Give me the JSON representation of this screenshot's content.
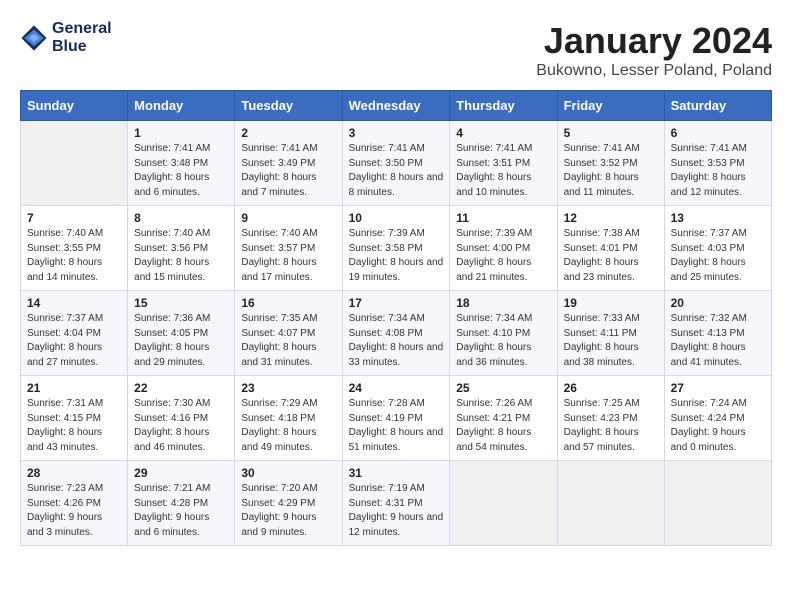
{
  "header": {
    "logo_line1": "General",
    "logo_line2": "Blue",
    "month": "January 2024",
    "location": "Bukowno, Lesser Poland, Poland"
  },
  "weekdays": [
    "Sunday",
    "Monday",
    "Tuesday",
    "Wednesday",
    "Thursday",
    "Friday",
    "Saturday"
  ],
  "weeks": [
    [
      {
        "day": "",
        "sunrise": "",
        "sunset": "",
        "daylight": ""
      },
      {
        "day": "1",
        "sunrise": "Sunrise: 7:41 AM",
        "sunset": "Sunset: 3:48 PM",
        "daylight": "Daylight: 8 hours and 6 minutes."
      },
      {
        "day": "2",
        "sunrise": "Sunrise: 7:41 AM",
        "sunset": "Sunset: 3:49 PM",
        "daylight": "Daylight: 8 hours and 7 minutes."
      },
      {
        "day": "3",
        "sunrise": "Sunrise: 7:41 AM",
        "sunset": "Sunset: 3:50 PM",
        "daylight": "Daylight: 8 hours and 8 minutes."
      },
      {
        "day": "4",
        "sunrise": "Sunrise: 7:41 AM",
        "sunset": "Sunset: 3:51 PM",
        "daylight": "Daylight: 8 hours and 10 minutes."
      },
      {
        "day": "5",
        "sunrise": "Sunrise: 7:41 AM",
        "sunset": "Sunset: 3:52 PM",
        "daylight": "Daylight: 8 hours and 11 minutes."
      },
      {
        "day": "6",
        "sunrise": "Sunrise: 7:41 AM",
        "sunset": "Sunset: 3:53 PM",
        "daylight": "Daylight: 8 hours and 12 minutes."
      }
    ],
    [
      {
        "day": "7",
        "sunrise": "Sunrise: 7:40 AM",
        "sunset": "Sunset: 3:55 PM",
        "daylight": "Daylight: 8 hours and 14 minutes."
      },
      {
        "day": "8",
        "sunrise": "Sunrise: 7:40 AM",
        "sunset": "Sunset: 3:56 PM",
        "daylight": "Daylight: 8 hours and 15 minutes."
      },
      {
        "day": "9",
        "sunrise": "Sunrise: 7:40 AM",
        "sunset": "Sunset: 3:57 PM",
        "daylight": "Daylight: 8 hours and 17 minutes."
      },
      {
        "day": "10",
        "sunrise": "Sunrise: 7:39 AM",
        "sunset": "Sunset: 3:58 PM",
        "daylight": "Daylight: 8 hours and 19 minutes."
      },
      {
        "day": "11",
        "sunrise": "Sunrise: 7:39 AM",
        "sunset": "Sunset: 4:00 PM",
        "daylight": "Daylight: 8 hours and 21 minutes."
      },
      {
        "day": "12",
        "sunrise": "Sunrise: 7:38 AM",
        "sunset": "Sunset: 4:01 PM",
        "daylight": "Daylight: 8 hours and 23 minutes."
      },
      {
        "day": "13",
        "sunrise": "Sunrise: 7:37 AM",
        "sunset": "Sunset: 4:03 PM",
        "daylight": "Daylight: 8 hours and 25 minutes."
      }
    ],
    [
      {
        "day": "14",
        "sunrise": "Sunrise: 7:37 AM",
        "sunset": "Sunset: 4:04 PM",
        "daylight": "Daylight: 8 hours and 27 minutes."
      },
      {
        "day": "15",
        "sunrise": "Sunrise: 7:36 AM",
        "sunset": "Sunset: 4:05 PM",
        "daylight": "Daylight: 8 hours and 29 minutes."
      },
      {
        "day": "16",
        "sunrise": "Sunrise: 7:35 AM",
        "sunset": "Sunset: 4:07 PM",
        "daylight": "Daylight: 8 hours and 31 minutes."
      },
      {
        "day": "17",
        "sunrise": "Sunrise: 7:34 AM",
        "sunset": "Sunset: 4:08 PM",
        "daylight": "Daylight: 8 hours and 33 minutes."
      },
      {
        "day": "18",
        "sunrise": "Sunrise: 7:34 AM",
        "sunset": "Sunset: 4:10 PM",
        "daylight": "Daylight: 8 hours and 36 minutes."
      },
      {
        "day": "19",
        "sunrise": "Sunrise: 7:33 AM",
        "sunset": "Sunset: 4:11 PM",
        "daylight": "Daylight: 8 hours and 38 minutes."
      },
      {
        "day": "20",
        "sunrise": "Sunrise: 7:32 AM",
        "sunset": "Sunset: 4:13 PM",
        "daylight": "Daylight: 8 hours and 41 minutes."
      }
    ],
    [
      {
        "day": "21",
        "sunrise": "Sunrise: 7:31 AM",
        "sunset": "Sunset: 4:15 PM",
        "daylight": "Daylight: 8 hours and 43 minutes."
      },
      {
        "day": "22",
        "sunrise": "Sunrise: 7:30 AM",
        "sunset": "Sunset: 4:16 PM",
        "daylight": "Daylight: 8 hours and 46 minutes."
      },
      {
        "day": "23",
        "sunrise": "Sunrise: 7:29 AM",
        "sunset": "Sunset: 4:18 PM",
        "daylight": "Daylight: 8 hours and 49 minutes."
      },
      {
        "day": "24",
        "sunrise": "Sunrise: 7:28 AM",
        "sunset": "Sunset: 4:19 PM",
        "daylight": "Daylight: 8 hours and 51 minutes."
      },
      {
        "day": "25",
        "sunrise": "Sunrise: 7:26 AM",
        "sunset": "Sunset: 4:21 PM",
        "daylight": "Daylight: 8 hours and 54 minutes."
      },
      {
        "day": "26",
        "sunrise": "Sunrise: 7:25 AM",
        "sunset": "Sunset: 4:23 PM",
        "daylight": "Daylight: 8 hours and 57 minutes."
      },
      {
        "day": "27",
        "sunrise": "Sunrise: 7:24 AM",
        "sunset": "Sunset: 4:24 PM",
        "daylight": "Daylight: 9 hours and 0 minutes."
      }
    ],
    [
      {
        "day": "28",
        "sunrise": "Sunrise: 7:23 AM",
        "sunset": "Sunset: 4:26 PM",
        "daylight": "Daylight: 9 hours and 3 minutes."
      },
      {
        "day": "29",
        "sunrise": "Sunrise: 7:21 AM",
        "sunset": "Sunset: 4:28 PM",
        "daylight": "Daylight: 9 hours and 6 minutes."
      },
      {
        "day": "30",
        "sunrise": "Sunrise: 7:20 AM",
        "sunset": "Sunset: 4:29 PM",
        "daylight": "Daylight: 9 hours and 9 minutes."
      },
      {
        "day": "31",
        "sunrise": "Sunrise: 7:19 AM",
        "sunset": "Sunset: 4:31 PM",
        "daylight": "Daylight: 9 hours and 12 minutes."
      },
      {
        "day": "",
        "sunrise": "",
        "sunset": "",
        "daylight": ""
      },
      {
        "day": "",
        "sunrise": "",
        "sunset": "",
        "daylight": ""
      },
      {
        "day": "",
        "sunrise": "",
        "sunset": "",
        "daylight": ""
      }
    ]
  ]
}
